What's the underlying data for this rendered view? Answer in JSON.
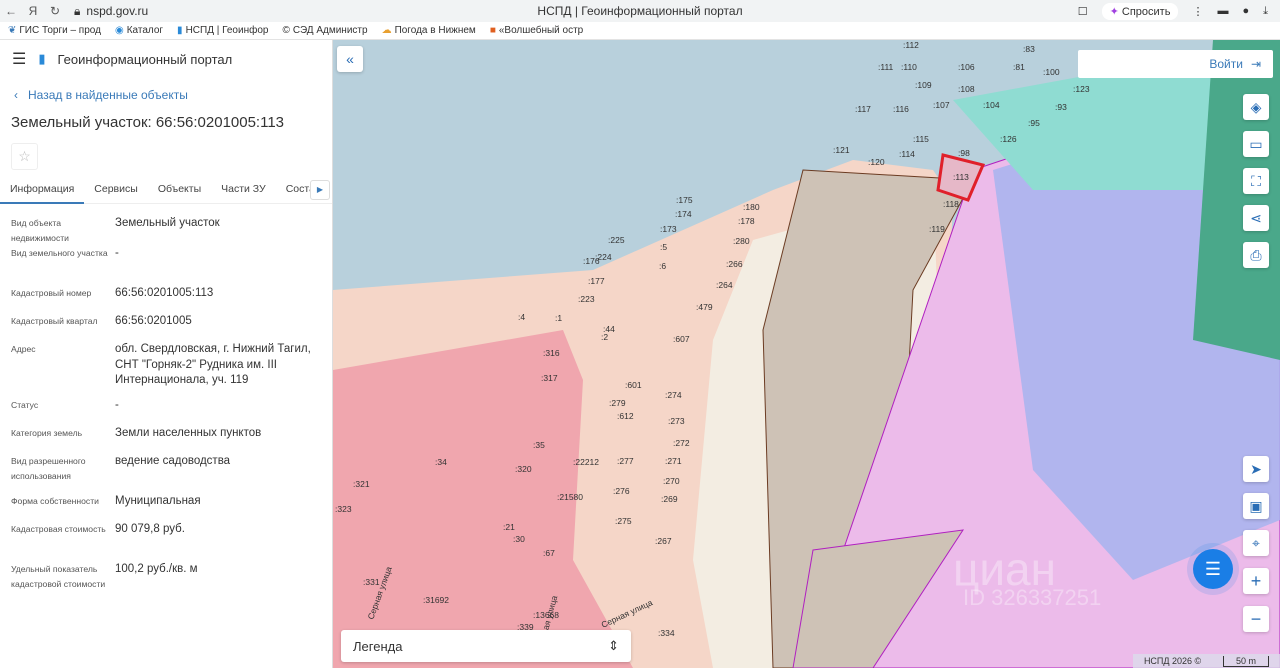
{
  "browser": {
    "url": "nspd.gov.ru",
    "page_title": "НСПД | Геоинформационный портал",
    "ask_label": "Спросить",
    "bookmarks": [
      "ГИС Торги – прод",
      "Каталог",
      "НСПД | Геоинфор",
      "СЭД Администр",
      "Погода в Нижнем",
      "«Волшебный остр"
    ]
  },
  "app": {
    "title": "Геоинформационный портал",
    "back_label": "Назад в найденные объекты",
    "object_title": "Земельный участок: 66:56:0201005:113",
    "tabs": [
      {
        "label": "Информация",
        "active": true
      },
      {
        "label": "Сервисы"
      },
      {
        "label": "Объекты"
      },
      {
        "label": "Части ЗУ"
      },
      {
        "label": "Состав"
      }
    ],
    "fields": [
      {
        "label": "Вид объекта недвижимости",
        "value": "Земельный участок"
      },
      {
        "label": "Вид земельного участка",
        "value": "-"
      },
      {
        "label": "Кадастровый номер",
        "value": "66:56:0201005:113"
      },
      {
        "label": "Кадастровый квартал",
        "value": "66:56:0201005"
      },
      {
        "label": "Адрес",
        "value": "обл. Свердловская, г. Нижний Тагил, СНТ \"Горняк-2\" Рудника им. III Интернационала, уч. 119"
      },
      {
        "label": "Статус",
        "value": "-"
      },
      {
        "label": "Категория земель",
        "value": "Земли населенных пунктов"
      },
      {
        "label": "Вид разрешенного использования",
        "value": "ведение садоводства"
      },
      {
        "label": "Форма собственности",
        "value": "Муниципальная"
      },
      {
        "label": "Кадастровая стоимость",
        "value": "90 079,8 руб."
      },
      {
        "label": "Удельный показатель кадастровой стоимости",
        "value": "100,2 руб./кв. м"
      }
    ]
  },
  "map": {
    "login_label": "Войти",
    "legend_label": "Легенда",
    "credit": "НСПД 2026 ©",
    "scale": "50 m",
    "watermark": "циан ID 326337251",
    "highlight_color": "#e0202a",
    "labels": [
      ":113",
      ":118",
      ":119",
      ":98",
      ":114",
      ":115",
      ":120",
      ":121",
      ":126",
      ":95",
      ":93",
      ":123",
      ":100",
      ":81",
      ":83",
      ":112",
      ":110",
      ":106",
      ":104",
      ":107",
      ":108",
      ":109",
      ":111",
      ":116",
      ":117",
      ":180",
      ":178",
      ":280",
      ":266",
      ":264",
      ":479",
      ":607",
      ":601",
      ":274",
      ":273",
      ":272",
      ":271",
      ":270",
      ":269",
      ":267",
      ":276",
      ":275",
      ":277",
      ":279",
      ":612",
      ":316",
      ":317",
      ":35",
      ":34",
      ":320",
      ":321",
      ":323",
      ":331",
      ":30",
      ":21",
      ":67",
      ":21580",
      ":22212",
      ":31692",
      ":13668",
      ":334",
      ":339",
      ":44",
      ":2",
      ":1",
      ":4",
      ":6",
      ":5",
      ":173",
      ":174",
      ":175",
      ":176",
      ":177",
      ":223",
      ":224",
      ":225"
    ],
    "streets": [
      "Серная улица",
      "Серная улица",
      "Серная улица"
    ]
  }
}
